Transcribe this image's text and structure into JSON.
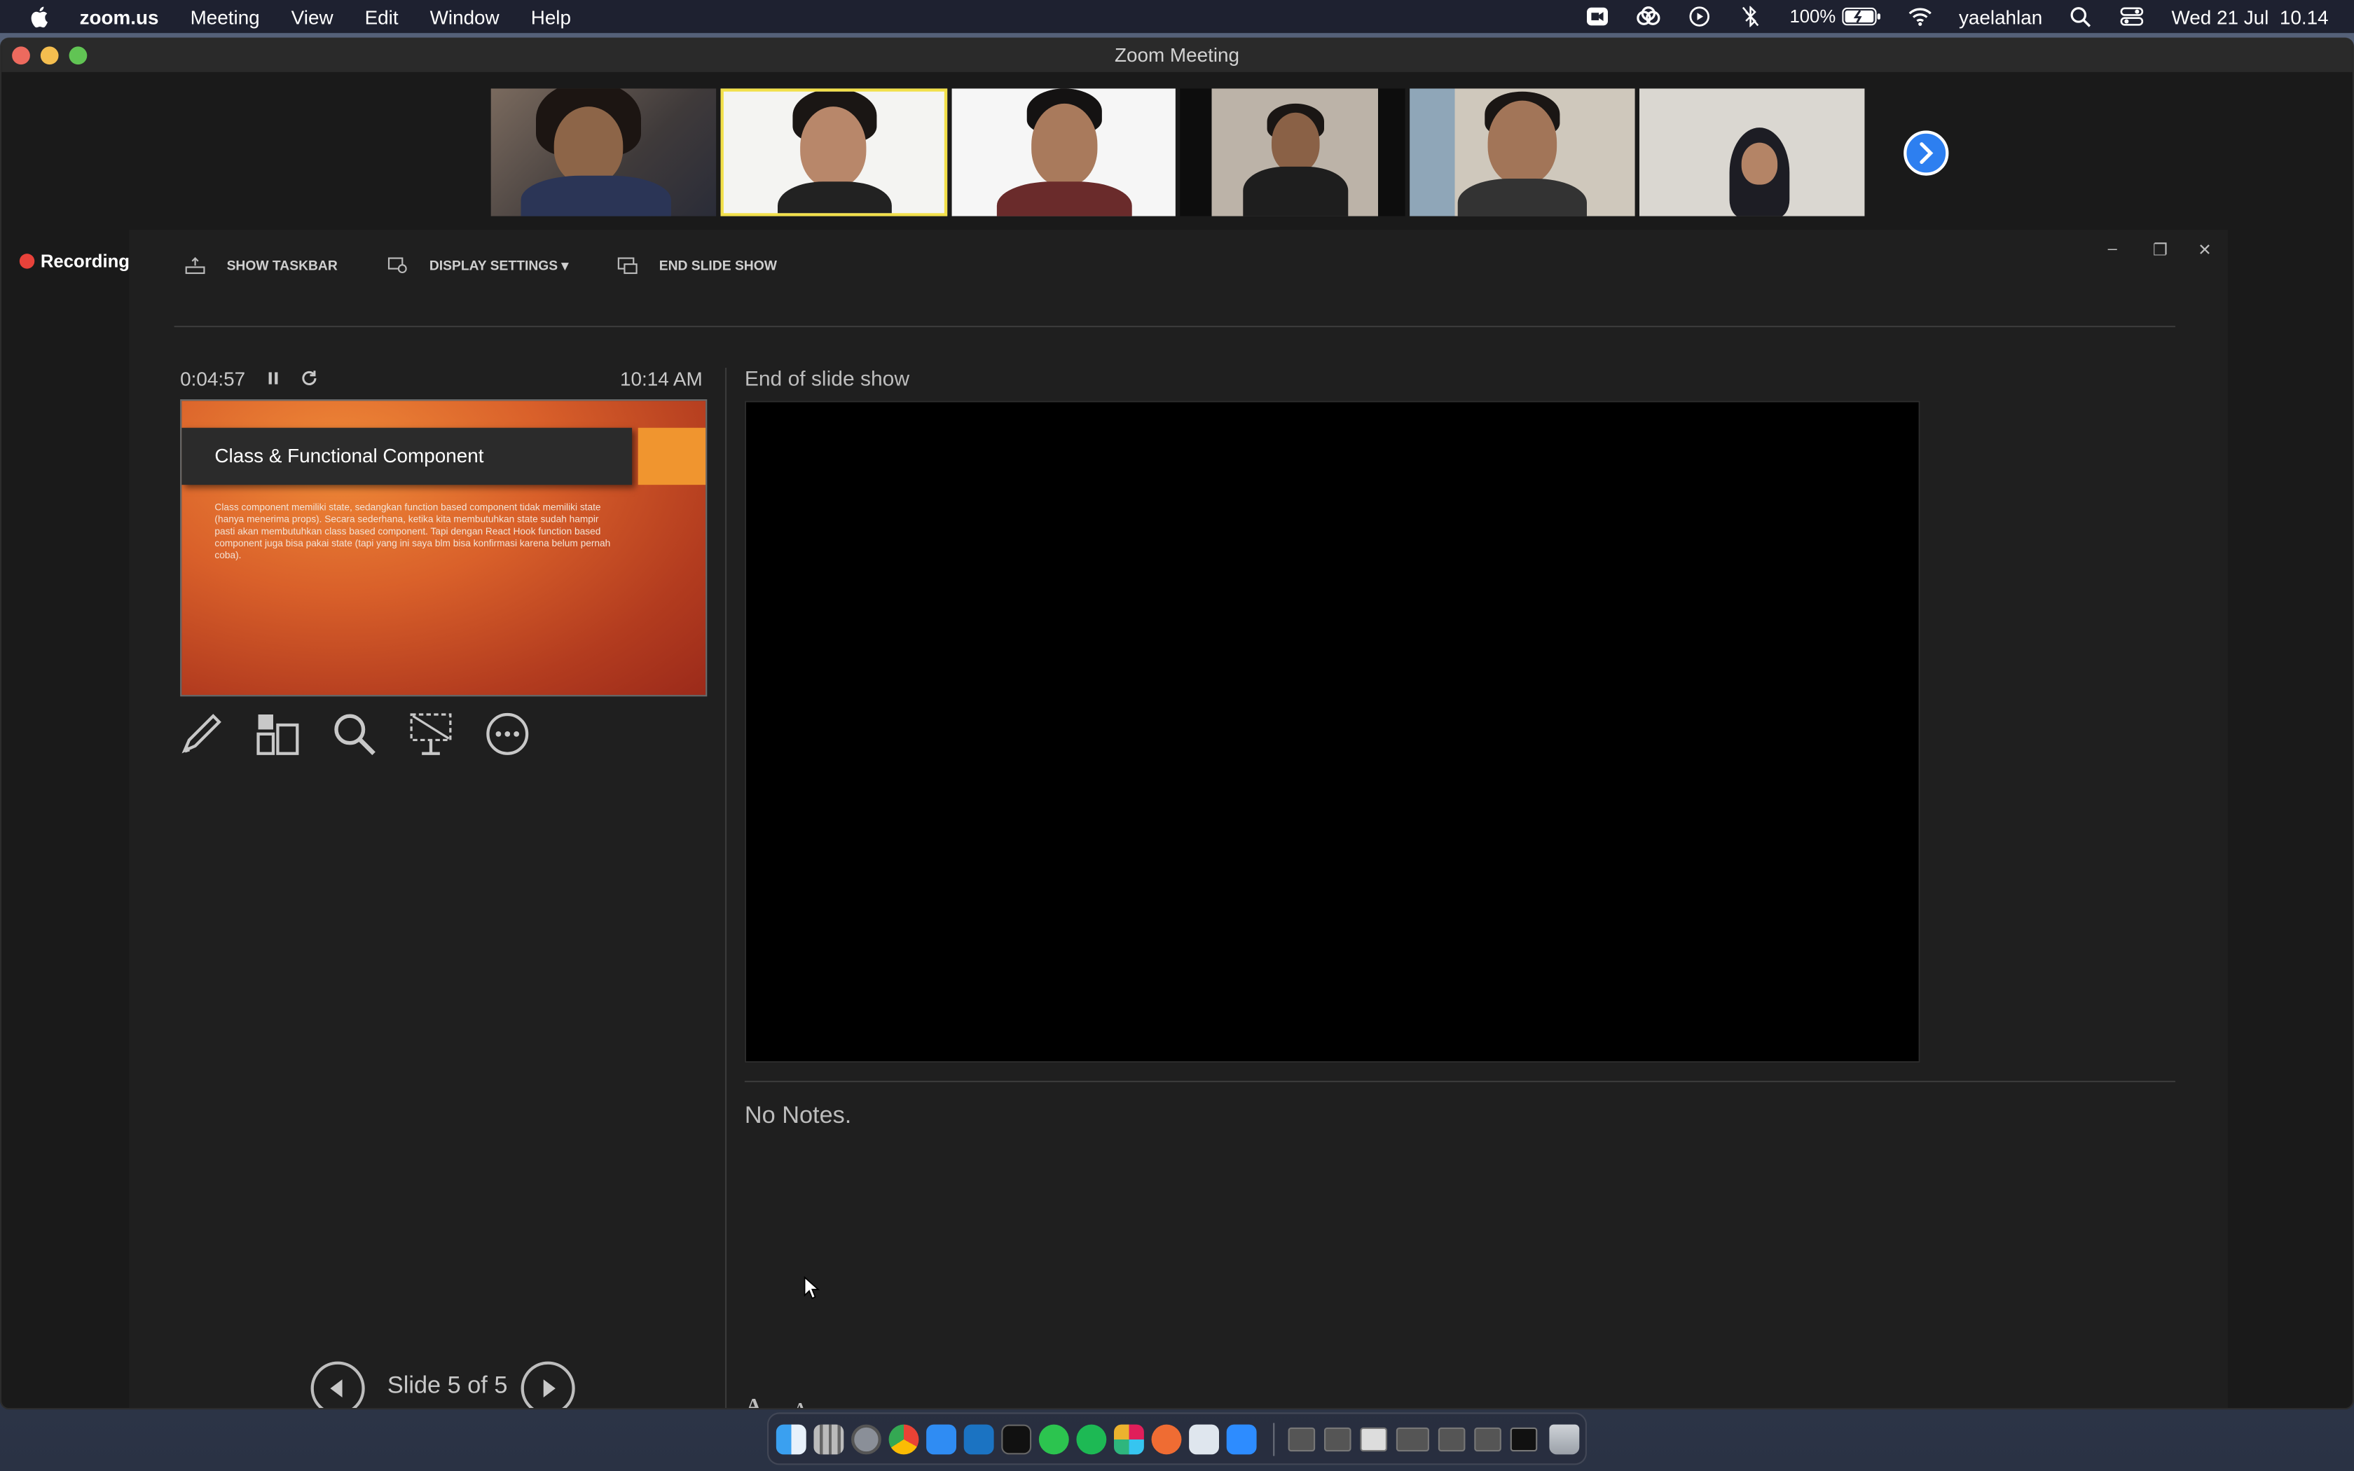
{
  "menubar": {
    "app": "zoom.us",
    "items": [
      "Meeting",
      "View",
      "Edit",
      "Window",
      "Help"
    ],
    "battery": "100%",
    "user": "yaelahlan",
    "datetime": "Wed 21 Jul  10.14"
  },
  "window": {
    "title": "Zoom Meeting"
  },
  "recording": {
    "label": "Recording"
  },
  "presenter": {
    "toolbar": {
      "show_taskbar": "SHOW TASKBAR",
      "display_settings": "DISPLAY SETTINGS ▾",
      "end_slide_show": "END SLIDE SHOW"
    },
    "window_controls": {
      "minimize": "–",
      "restore": "❐",
      "close": "✕"
    },
    "timer": "0:04:57",
    "clock": "10:14 AM",
    "current_slide": {
      "title": "Class & Functional Component",
      "body": "Class component memiliki state, sedangkan function based component tidak memiliki state (hanya menerima props). Secara sederhana, ketika kita membutuhkan state sudah hampir pasti akan membutuhkan class based component. Tapi dengan React Hook function based component juga bisa pakai state (tapi yang ini saya blm bisa konfirmasi karena belum pernah coba)."
    },
    "next_label": "End of slide show",
    "notes": "No Notes.",
    "font_increase": "A",
    "font_decrease": "A",
    "slide_counter": "Slide 5 of 5"
  },
  "colors": {
    "accent": "#2d7ff0",
    "recording": "#e8423a",
    "slide_orange": "#d9602a"
  }
}
